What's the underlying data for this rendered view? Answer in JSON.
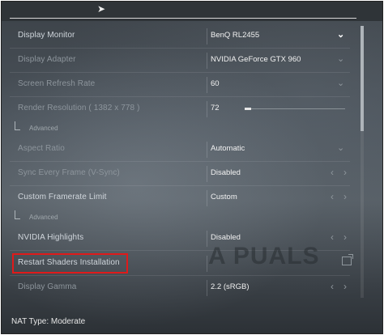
{
  "settings": {
    "rows": [
      {
        "label": "Display Monitor",
        "value": "BenQ RL2455",
        "control": "dropdown-active"
      },
      {
        "label": "Display Adapter",
        "value": "NVIDIA GeForce GTX 960",
        "control": "dropdown-dim"
      },
      {
        "label": "Screen Refresh Rate",
        "value": "60",
        "control": "dropdown-dim"
      },
      {
        "label": "Render Resolution ( 1382 x 778 )",
        "value": "72",
        "control": "slider",
        "slider_level": 0.0
      },
      {
        "label": "Aspect Ratio",
        "value": "Automatic",
        "control": "dropdown-dim"
      },
      {
        "label": "Sync Every Frame (V-Sync)",
        "value": "Disabled",
        "control": "arrows"
      },
      {
        "label": "Custom Framerate Limit",
        "value": "Custom",
        "control": "arrows"
      },
      {
        "label": "NVIDIA Highlights",
        "value": "Disabled",
        "control": "arrows"
      },
      {
        "label": "Restart Shaders Installation",
        "value": "",
        "control": "external"
      },
      {
        "label": "Display Gamma",
        "value": "2.2 (sRGB)",
        "control": "arrows"
      }
    ],
    "advanced_label": "Advanced"
  },
  "footer": {
    "nat_type": "NAT Type: Moderate"
  },
  "watermark": "A PUALS",
  "icons": [
    "cursor-icon",
    "chevron-down-icon",
    "chevron-left-icon",
    "chevron-right-icon",
    "external-link-icon"
  ],
  "colors": {
    "highlight": "#e01a1a",
    "text": "#d0d6dc",
    "value": "#f2f2f2"
  }
}
